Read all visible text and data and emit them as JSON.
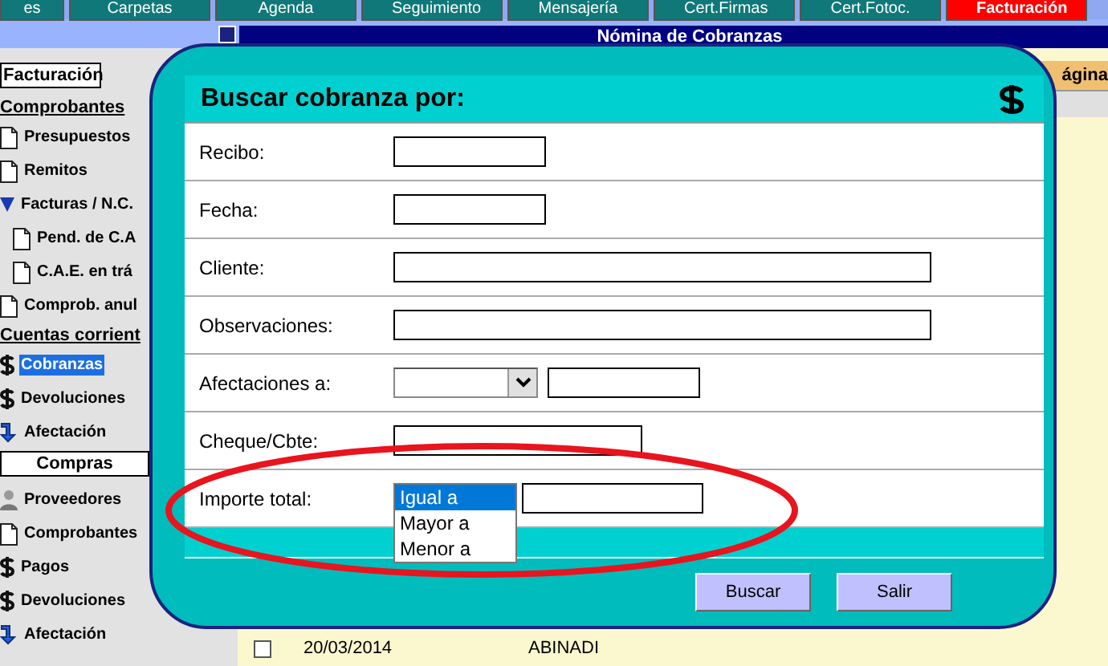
{
  "top_tabs": [
    {
      "label": "es",
      "selected": false
    },
    {
      "label": "Carpetas",
      "selected": false
    },
    {
      "label": "Agenda",
      "selected": false
    },
    {
      "label": "Seguimiento",
      "selected": false
    },
    {
      "label": "Mensajería",
      "selected": false
    },
    {
      "label": "Cert.Firmas",
      "selected": false
    },
    {
      "label": "Cert.Fotoc.",
      "selected": false
    },
    {
      "label": "Facturación",
      "selected": true
    }
  ],
  "window": {
    "title": "Nómina de Cobranzas"
  },
  "sidebar": {
    "items": [
      {
        "kind": "header",
        "label": "Facturación"
      },
      {
        "kind": "group",
        "label": "Comprobantes"
      },
      {
        "kind": "document",
        "label": "Presupuestos",
        "selected": false
      },
      {
        "kind": "document",
        "label": "Remitos",
        "selected": false
      },
      {
        "kind": "folder",
        "label": "Facturas / N.C.",
        "selected": false,
        "children": [
          {
            "kind": "document",
            "label": "Pend. de C.A",
            "selected": false
          },
          {
            "kind": "document",
            "label": "C.A.E. en trá",
            "selected": false
          }
        ]
      },
      {
        "kind": "document",
        "label": "Comprob. anul",
        "selected": false
      },
      {
        "kind": "group",
        "label": "Cuentas corrient"
      },
      {
        "kind": "payment",
        "label": "Cobranzas",
        "selected": true
      },
      {
        "kind": "payment",
        "label": "Devoluciones",
        "selected": false
      },
      {
        "kind": "transfer",
        "label": "Afectación",
        "selected": false
      },
      {
        "kind": "header",
        "label": "Compras"
      },
      {
        "kind": "people",
        "label": "Proveedores",
        "selected": false
      },
      {
        "kind": "document",
        "label": "Comprobantes",
        "selected": false
      },
      {
        "kind": "payment",
        "label": "Pagos",
        "selected": false
      },
      {
        "kind": "payment",
        "label": "Devoluciones",
        "selected": false
      },
      {
        "kind": "transfer",
        "label": "Afectación",
        "selected": false
      }
    ]
  },
  "page": {
    "header_fragment": "ágina",
    "rows": [
      {
        "checked": false,
        "date": "20/03/2014",
        "name": "ABINADI"
      }
    ]
  },
  "dialog": {
    "title": "Buscar cobranza por:",
    "fields": [
      {
        "kind": "short",
        "label": "Recibo:"
      },
      {
        "kind": "short",
        "label": "Fecha:"
      },
      {
        "kind": "long",
        "label": "Cliente:"
      },
      {
        "kind": "long",
        "label": "Observaciones:"
      },
      {
        "kind": "select-text",
        "label": "Afectaciones a:"
      },
      {
        "kind": "medium",
        "label": "Cheque/Cbte:"
      },
      {
        "kind": "listbox-text",
        "label": "Importe total:",
        "options": [
          {
            "label": "Igual a",
            "selected": true
          },
          {
            "label": "Mayor a",
            "selected": false
          },
          {
            "label": "Menor a",
            "selected": false
          }
        ]
      }
    ],
    "buttons": [
      "Buscar",
      "Salir"
    ]
  },
  "annotation": {
    "kind": "ellipse"
  }
}
